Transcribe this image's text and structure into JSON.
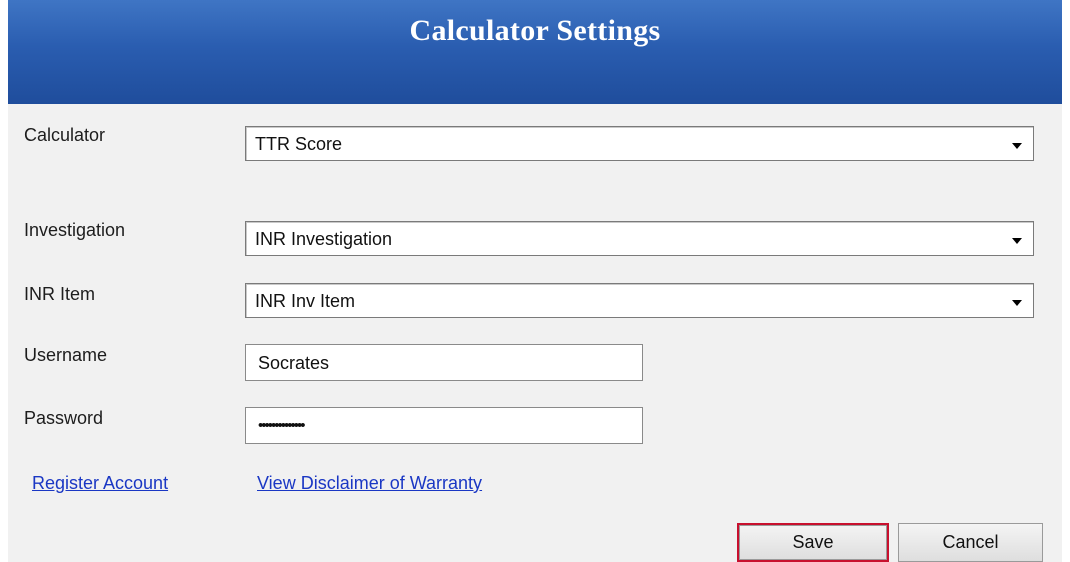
{
  "header": {
    "title": "Calculator Settings"
  },
  "form": {
    "calculator": {
      "label": "Calculator",
      "value": "TTR Score"
    },
    "investigation": {
      "label": "Investigation",
      "value": "INR Investigation"
    },
    "inr_item": {
      "label": "INR Item",
      "value": "INR Inv Item"
    },
    "username": {
      "label": "Username",
      "value": "Socrates"
    },
    "password": {
      "label": "Password",
      "value": "••••••••••••••"
    }
  },
  "links": {
    "register": "Register Account",
    "disclaimer": "View Disclaimer of Warranty"
  },
  "buttons": {
    "save": "Save",
    "cancel": "Cancel"
  },
  "colors": {
    "header": "#2a5db0",
    "link": "#1a37c4",
    "focus_border": "#c8102e",
    "panel": "#f1f1f1"
  }
}
